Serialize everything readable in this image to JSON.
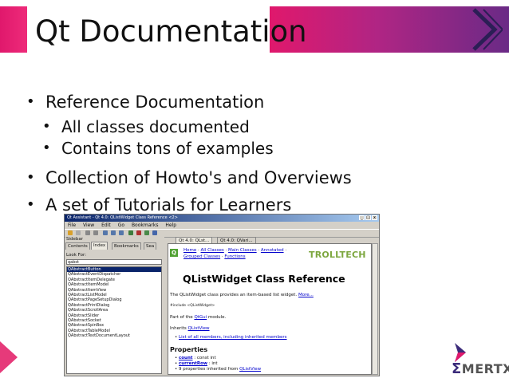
{
  "slide": {
    "title": "Qt Documentation",
    "bullets": [
      {
        "text": "Reference Documentation",
        "level": 1
      },
      {
        "text": "All classes documented",
        "level": 2
      },
      {
        "text": "Contains tons of examples",
        "level": 2
      },
      {
        "text": "Collection of Howto's and Overviews",
        "level": 1
      },
      {
        "text": "A set of Tutorials for Learners",
        "level": 1
      }
    ],
    "bullet_glyph": "•",
    "logo_sigma": "Σ",
    "logo_text": "MERTXE",
    "colors": {
      "accent_pink": "#e0186c",
      "accent_purple": "#6a2a86"
    }
  },
  "app": {
    "window_title": "Qt Assistant - Qt 4.0: QListWidget Class Reference <2>",
    "window_controls": [
      "_",
      "□",
      "x"
    ],
    "menu": [
      "File",
      "View",
      "Edit",
      "Go",
      "Bookmarks",
      "Help"
    ],
    "sidebar": {
      "header": "Sidebar",
      "tabs": [
        "Contents",
        "Index",
        "Bookmarks",
        "Sea"
      ],
      "active_tab": "Index",
      "look_for_label": "Look For:",
      "search_value": "qabst",
      "items": [
        "QAbstractButton",
        "QAbstractEventDispatcher",
        "QAbstractItemDelegate",
        "QAbstractItemModel",
        "QAbstractItemView",
        "QAbstractListModel",
        "QAbstractPageSetupDialog",
        "QAbstractPrintDialog",
        "QAbstractScrollArea",
        "QAbstractSlider",
        "QAbstractSocket",
        "QAbstractSpinBox",
        "QAbstractTableModel",
        "QAbstractTextDocumentLayout"
      ]
    },
    "doc_tabs": [
      "Qt 4.0: QLst...",
      "Qt 4.0: QVari..."
    ],
    "doc": {
      "nav_line1": [
        "Home",
        "All Classes",
        "Main Classes",
        "Annotated"
      ],
      "nav_line2": [
        "Grouped Classes",
        "Functions"
      ],
      "brand": "TROLLTECH",
      "title": "QListWidget Class Reference",
      "intro": "The QListWidget class provides an item-based list widget.",
      "more_link": "More...",
      "include": "#include <QListWidget>",
      "part_of_prefix": "Part of the",
      "part_of_link": "QtGui",
      "part_of_suffix": "module.",
      "inherits_prefix": "Inherits",
      "inherits_link": "QListView",
      "members_link": "List of all members, including inherited members",
      "properties_heading": "Properties",
      "properties": [
        {
          "name": "count",
          "type": ": const int"
        },
        {
          "name": "currentRow",
          "type": ": int"
        },
        {
          "name": "9 properties inherited from",
          "link": "QListView"
        }
      ]
    }
  }
}
